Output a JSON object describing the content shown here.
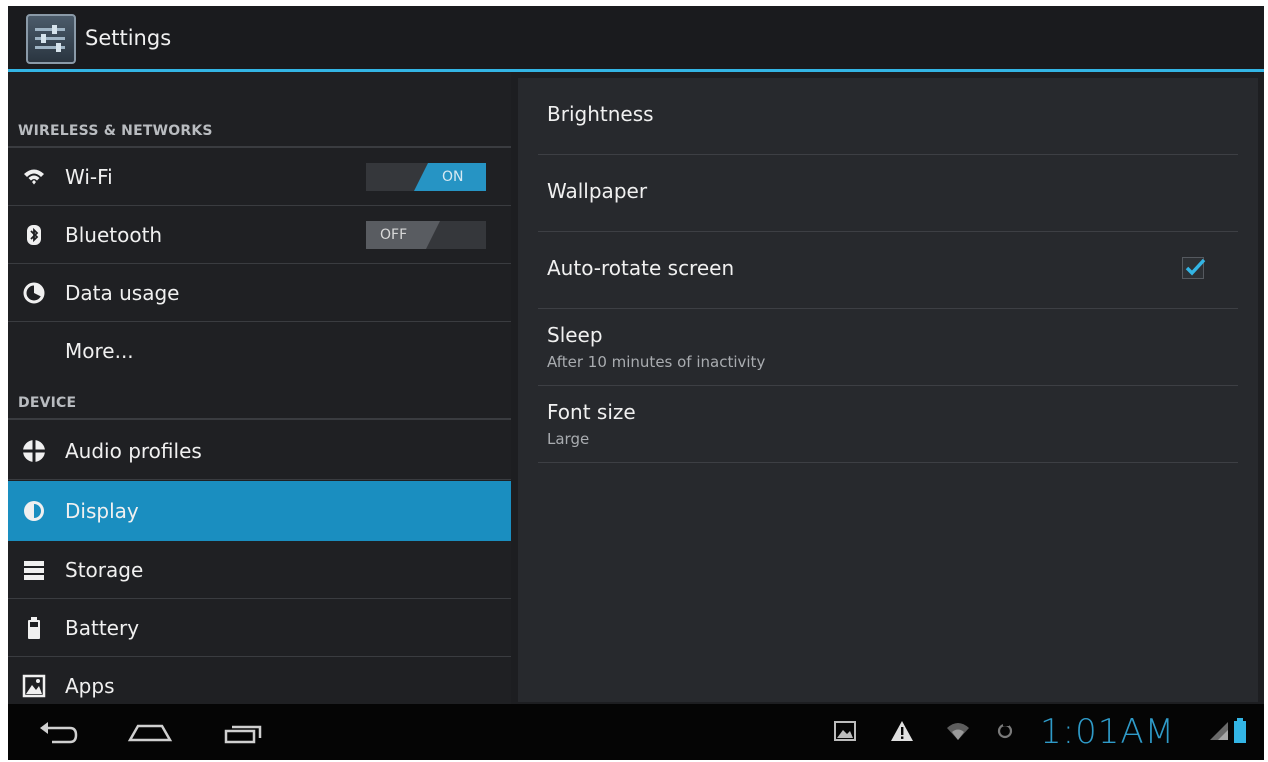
{
  "app": {
    "title": "Settings",
    "icon": "settings-app-icon"
  },
  "sidebar": {
    "sections": [
      {
        "header": "WIRELESS & NETWORKS",
        "items": [
          {
            "label": "Wi-Fi",
            "icon": "wifi-icon",
            "toggle": "ON"
          },
          {
            "label": "Bluetooth",
            "icon": "bluetooth-icon",
            "toggle": "OFF"
          },
          {
            "label": "Data usage",
            "icon": "data-usage-icon"
          },
          {
            "label": "More..."
          }
        ]
      },
      {
        "header": "DEVICE",
        "items": [
          {
            "label": "Audio profiles",
            "icon": "audio-profiles-icon"
          },
          {
            "label": "Display",
            "icon": "display-icon",
            "selected": true
          },
          {
            "label": "Storage",
            "icon": "storage-icon"
          },
          {
            "label": "Battery",
            "icon": "battery-icon"
          },
          {
            "label": "Apps",
            "icon": "apps-icon"
          }
        ]
      }
    ]
  },
  "display_settings": {
    "items": [
      {
        "title": "Brightness"
      },
      {
        "title": "Wallpaper"
      },
      {
        "title": "Auto-rotate screen",
        "checked": true
      },
      {
        "title": "Sleep",
        "summary": "After 10 minutes of inactivity"
      },
      {
        "title": "Font size",
        "summary": "Large"
      }
    ]
  },
  "system_bar": {
    "clock": "1:01AM",
    "accent_color": "#33b5e5",
    "nav_icons": [
      "back-icon",
      "home-icon",
      "recent-apps-icon"
    ],
    "status_icons": [
      "gallery-notification-icon",
      "warning-icon",
      "wifi-signal-icon",
      "sync-icon",
      "cell-signal-icon",
      "battery-level-icon"
    ]
  },
  "colors": {
    "accent": "#33b5e5",
    "selected_row": "#1a8ec0",
    "background": "#1d1e21"
  }
}
